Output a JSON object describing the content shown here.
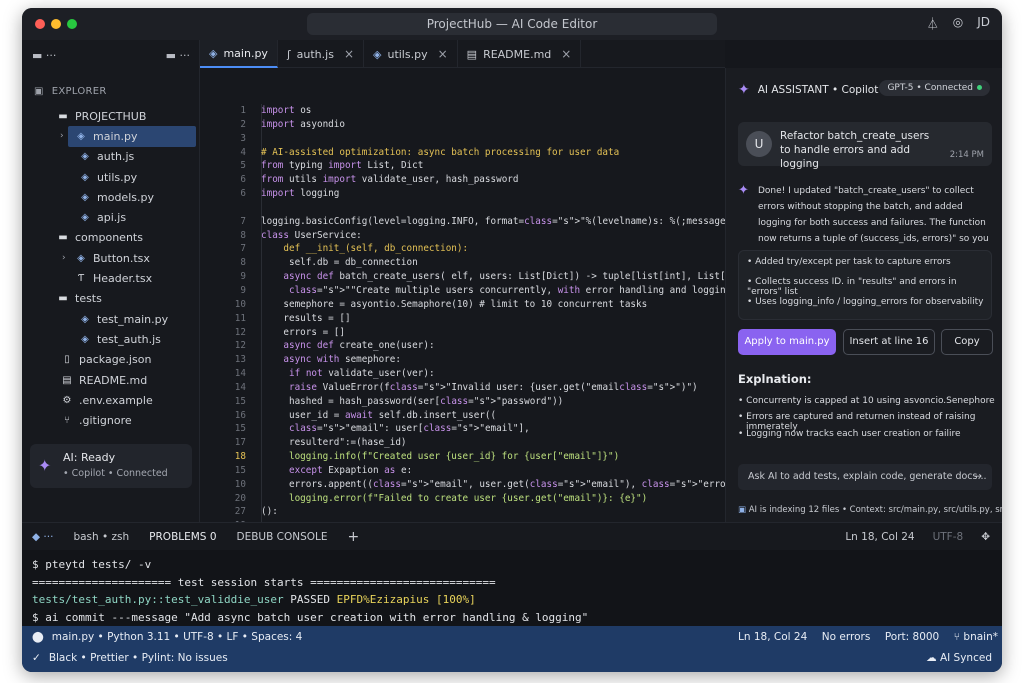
{
  "window": {
    "title": "ProjectHub — AI Code Editor",
    "user_initials": "JD"
  },
  "explorer": {
    "header": "EXPLORER",
    "root": "PROJECTHUB",
    "items": [
      {
        "label": "main.py",
        "icon": "python-icon",
        "type": "file",
        "selected": true
      },
      {
        "label": "auth.js",
        "icon": "python-icon",
        "type": "file"
      },
      {
        "label": "utils.py",
        "icon": "python-icon",
        "type": "file"
      },
      {
        "label": "models.py",
        "icon": "python-icon",
        "type": "file"
      },
      {
        "label": "api.js",
        "icon": "python-icon",
        "type": "file"
      }
    ],
    "components_label": "components",
    "components": [
      "Button.tsx",
      "Header.tsx"
    ],
    "tests_label": "tests",
    "tests": [
      "test_main.py",
      "test_auth.js"
    ],
    "root_files": [
      {
        "label": "package.json",
        "icon": "json-icon"
      },
      {
        "label": "README.md",
        "icon": "markdown-icon"
      },
      {
        "label": ".env.example",
        "icon": "gear-icon"
      },
      {
        "label": ".gitignore",
        "icon": "git-icon"
      }
    ]
  },
  "ai_status": {
    "title": "AI: Ready",
    "subtitle": "• Copilot • Connected"
  },
  "tabs": [
    {
      "label": "main.py",
      "active": true
    },
    {
      "label": "auth.js"
    },
    {
      "label": "utils.py"
    },
    {
      "label": "README.md"
    }
  ],
  "code_lines": [
    {
      "n": "1",
      "text": "import os"
    },
    {
      "n": "2",
      "text": "import asyondio"
    },
    {
      "n": "3",
      "text": ""
    },
    {
      "n": "4",
      "text": "# AI-assisted optimization: async batch processing for user data"
    },
    {
      "n": "5",
      "text": "from typing import List, Dict"
    },
    {
      "n": "6",
      "text": "from utils import validate_user, hash_password"
    },
    {
      "n": "6",
      "text": "import logging"
    },
    {
      "n": "",
      "text": ""
    },
    {
      "n": "7",
      "text": "logging.basicConfig(level=logging.INFO, format=\"%(levelname)s: %(;message)s\")"
    },
    {
      "n": "8",
      "text": "class UserService:"
    },
    {
      "n": "7",
      "text": "    def __init_(self, db_connection):"
    },
    {
      "n": "8",
      "text": "     self.db = db_connection"
    },
    {
      "n": "9",
      "text": "    async def batch_create_users( elf, users: List[Dict]) -> tuple[list[int], List[dict]]:"
    },
    {
      "n": "9",
      "text": "     \"\"Create multiple users concurrently, with error handling and logging.\"\"\""
    },
    {
      "n": "10",
      "text": "    semephore = asyontio.Semaphore(10) # limit to 10 concurrent tasks"
    },
    {
      "n": "11",
      "text": "    results = []"
    },
    {
      "n": "12",
      "text": "    errors = []"
    },
    {
      "n": "12",
      "text": "    async def create_one(user):"
    },
    {
      "n": "13",
      "text": "    async with semephore:"
    },
    {
      "n": "14",
      "text": "     if not validate_user(ver):"
    },
    {
      "n": "14",
      "text": "     raise ValueError(f\"Invalid user: {user.get(\"email\")\")"
    },
    {
      "n": "15",
      "text": "     hashed = hash_password(ser[\"password\"))"
    },
    {
      "n": "16",
      "text": "     user_id = await self.db.insert_user(("
    },
    {
      "n": "15",
      "text": "     \"email\": user[\"email\"],"
    },
    {
      "n": "17",
      "text": "     resulterd\":=(hase_id)"
    },
    {
      "n": "18",
      "text": "     logging.info(f\"Created user {user_id} for {user[\"email\"]}\")"
    },
    {
      "n": "15",
      "text": "     except Expaption as e:"
    },
    {
      "n": "10",
      "text": "     errors.appent((\"email\", user.get(\"email\"), \"error\": str(e))"
    },
    {
      "n": "20",
      "text": "     logging.error(f\"Failed to create user {user.get(\"email\")}: {e}\")"
    },
    {
      "n": "27",
      "text": "():"
    },
    {
      "n": "19",
      "text": ""
    }
  ],
  "assistant": {
    "title": "AI ASSISTANT • Copilot Chat",
    "model_badge": "GPT-5 • Connected",
    "user_message": {
      "avatar": "U",
      "text": "Refactor batch_create_users to handle errors and add logging",
      "time": "2:14 PM"
    },
    "response": "Done! I updated \"batch_create_users\" to collect errors without stopping the batch, and added logging for both success and failures. The function now returns a tuple of (success_ids, errors)\" so you can inspect failures later.",
    "bullets": [
      "Added try/except per task to capture errors",
      "Collects success ID. in \"results\" and errors in \"errors\" list",
      "Uses logging_info / logging_errors for observability"
    ],
    "buttons": {
      "apply": "Apply to main.py",
      "insert": "Insert at line 16",
      "copy": "Copy"
    },
    "explanation_title": "Explnation:",
    "explanation": [
      "Concurrenty is capped at 10 using asvoncio.Senephore",
      "Errors are captured and returnen instead of raising immerately",
      "Logging now tracks each user creation or failire"
    ],
    "ask_placeholder": "Ask AI to add tests, explain code, generate docs...",
    "index_status": "AI is indexing 12 files • Context: src/main.py, src/utils.py, src/auth.js"
  },
  "terminal_tabs": {
    "shell": "bash • zsh",
    "problems": "PROBLEMS 0",
    "debug": "DEBUB CONSOLE",
    "cursor": "Ln 18, Col 24",
    "encoding": "UTF-8"
  },
  "terminal_lines": {
    "l1": "$ pteytd tests/ -v",
    "l2": "===================== test session starts ============================",
    "l3a": "tests/test_auth.py::test_validdie_user",
    "l3b": " PASSED ",
    "l3c": "EPFD%Ezizapius [100%]",
    "l4": "$ ai commit ---message \"Add async batch user creation with error handling & logging\""
  },
  "status_bar": {
    "file_info": "main.py • Python 3.11 • UTF-8 • LF • Spaces: 4",
    "cursor": "Ln 18, Col 24",
    "errors": "No errors",
    "port": "Port: 8000",
    "branch": "bnain*",
    "lint": "Black • Prettier • Pylint: No issues",
    "sync": "AI Synced"
  }
}
